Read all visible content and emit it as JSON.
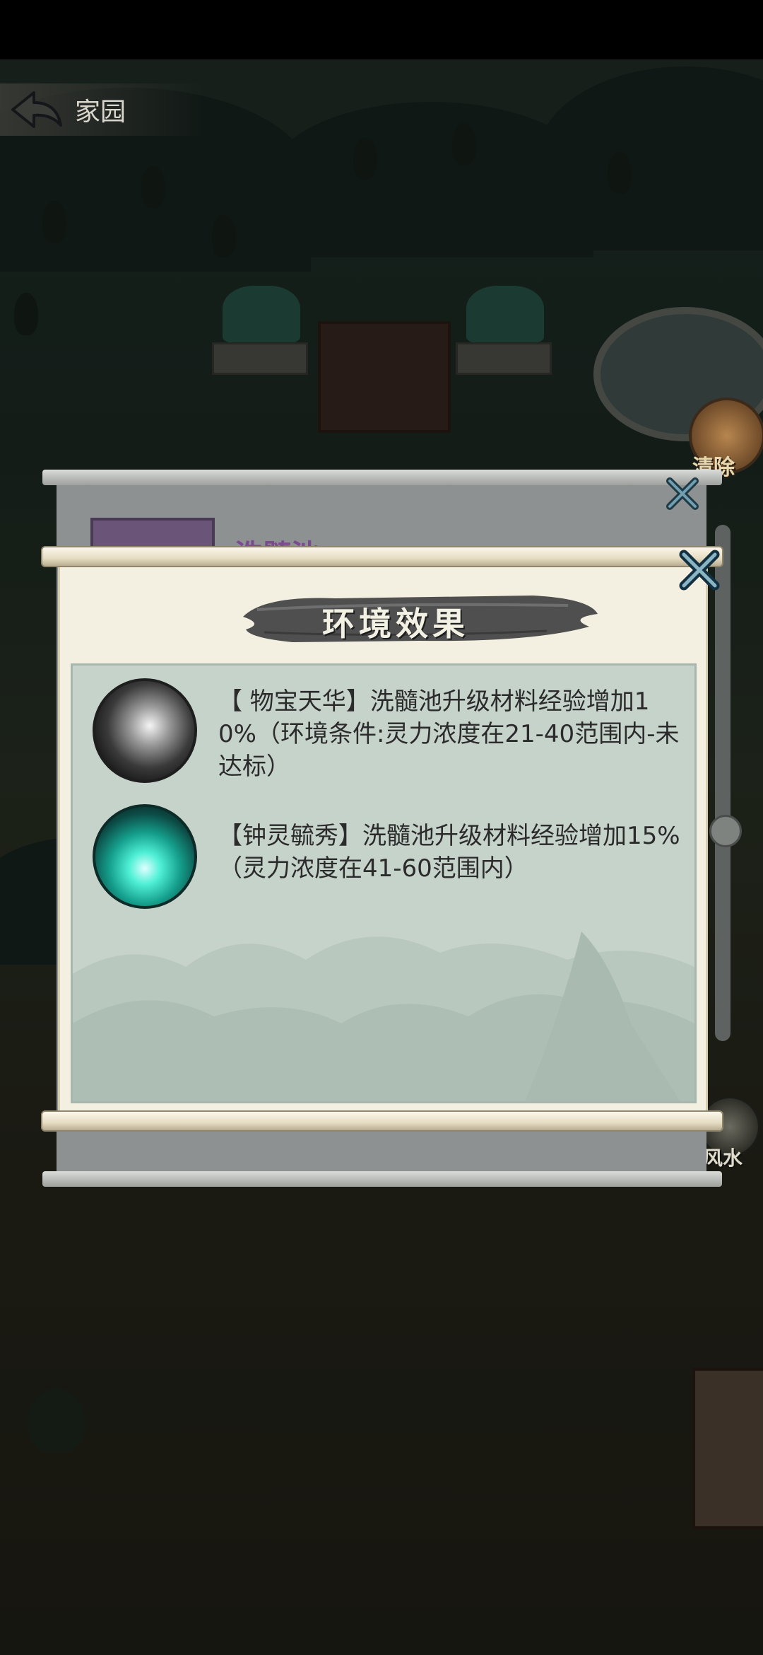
{
  "header": {
    "title": "家园"
  },
  "side_buttons": {
    "clear_label": "清除",
    "fengshui_label": "风水"
  },
  "underlying_dialog": {
    "title": "洗髓池"
  },
  "dialog": {
    "title": "环境效果",
    "effects": [
      {
        "icon": "silver-swirl-icon",
        "text": "【 物宝天华】洗髓池升级材料经验增加10%（环境条件:灵力浓度在21-40范围内-未达标）"
      },
      {
        "icon": "teal-spirit-flame-icon",
        "text": "【钟灵毓秀】洗髓池升级材料经验增加15%（灵力浓度在41-60范围内）"
      }
    ]
  }
}
